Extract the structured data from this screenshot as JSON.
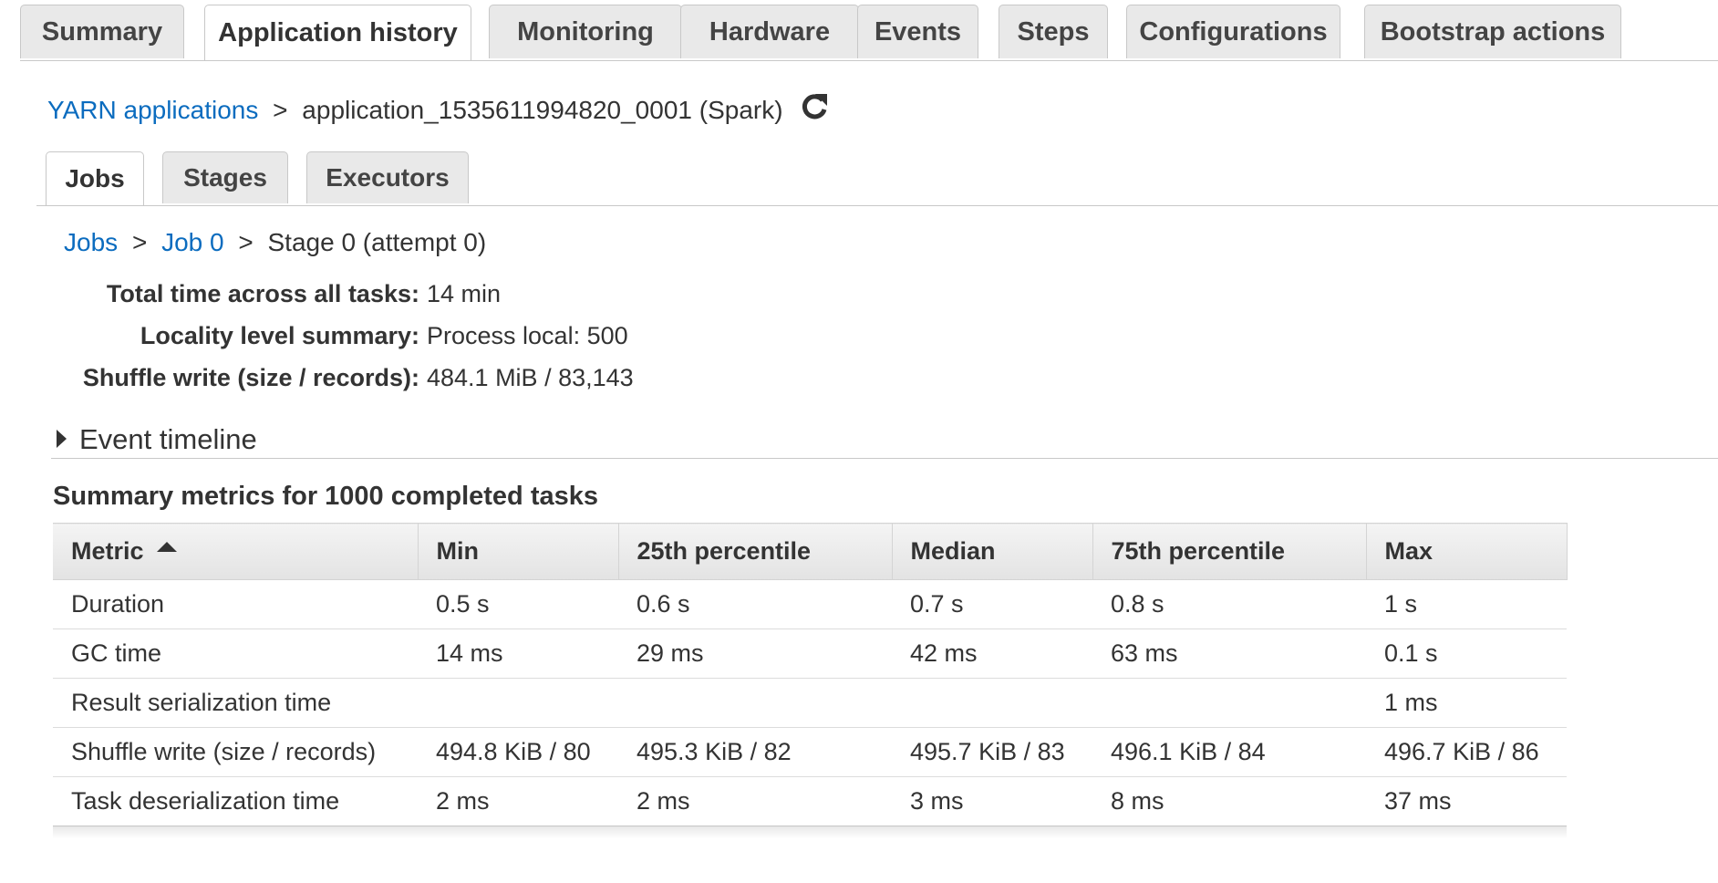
{
  "top_tabs": [
    {
      "label": "Summary"
    },
    {
      "label": "Application history",
      "active": true
    },
    {
      "label": "Monitoring"
    },
    {
      "label": "Hardware"
    },
    {
      "label": "Events"
    },
    {
      "label": "Steps"
    },
    {
      "label": "Configurations"
    },
    {
      "label": "Bootstrap actions"
    }
  ],
  "breadcrumb": {
    "root_link": "YARN applications",
    "separator": ">",
    "current": "application_1535611994820_0001 (Spark)",
    "refresh_icon": "refresh-icon"
  },
  "sub_tabs": [
    {
      "label": "Jobs",
      "active": true
    },
    {
      "label": "Stages"
    },
    {
      "label": "Executors"
    }
  ],
  "stage_breadcrumb": {
    "jobs_link": "Jobs",
    "job_link": "Job 0",
    "separator": ">",
    "current": "Stage 0 (attempt 0)"
  },
  "details": [
    {
      "label": "Total time across all tasks:",
      "value": "14 min"
    },
    {
      "label": "Locality level summary:",
      "value": "Process local: 500"
    },
    {
      "label": "Shuffle write (size / records):",
      "value": "484.1 MiB / 83,143"
    }
  ],
  "event_timeline": {
    "label": "Event timeline",
    "icon": "caret-right-icon"
  },
  "summary": {
    "title": "Summary metrics for 1000 completed tasks",
    "columns": [
      "Metric",
      "Min",
      "25th percentile",
      "Median",
      "75th percentile",
      "Max"
    ],
    "sorted_column_icon": "sort-ascending-icon",
    "rows": [
      [
        "Duration",
        "0.5 s",
        "0.6 s",
        "0.7 s",
        "0.8 s",
        "1 s"
      ],
      [
        "GC time",
        "14 ms",
        "29 ms",
        "42 ms",
        "63 ms",
        "0.1 s"
      ],
      [
        "Result serialization time",
        "",
        "",
        "",
        "",
        "1 ms"
      ],
      [
        "Shuffle write (size / records)",
        "494.8 KiB / 80",
        "495.3 KiB / 82",
        "495.7 KiB / 83",
        "496.1 KiB / 84",
        "496.7 KiB / 86"
      ],
      [
        "Task deserialization time",
        "2 ms",
        "2 ms",
        "3 ms",
        "8 ms",
        "37 ms"
      ]
    ]
  },
  "colors": {
    "link": "#0b6cbf",
    "tab_inactive": "#e9e9e9",
    "border": "#c8c8c8",
    "text": "#333333"
  }
}
